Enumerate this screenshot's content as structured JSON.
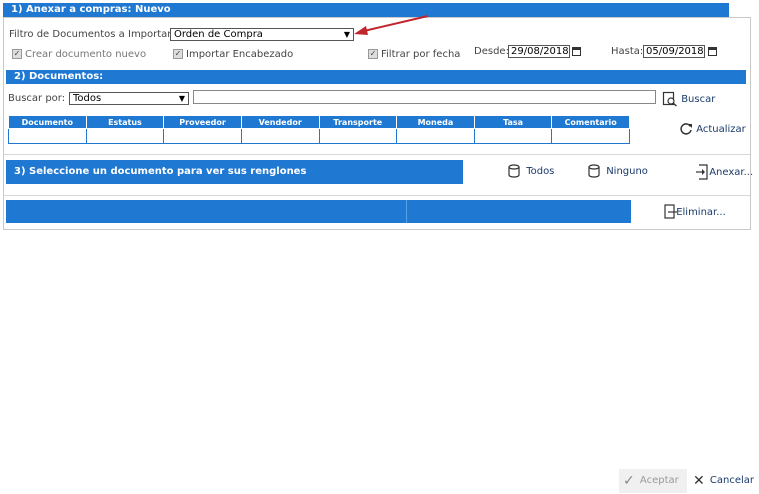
{
  "section1": {
    "title": "1) Anexar a compras: Nuevo",
    "filter_label": "Filtro de Documentos a Importar:",
    "filter_value": "Orden de Compra",
    "create_doc_label": "Crear documento nuevo",
    "import_header_label": "Importar Encabezado",
    "filter_date_label": "Filtrar por fecha",
    "from_label": "Desde:",
    "from_value": "29/08/2018",
    "to_label": "Hasta:",
    "to_value": "05/09/2018"
  },
  "section2": {
    "title": "2) Documentos:",
    "search_by_label": "Buscar por:",
    "search_by_value": "Todos",
    "search_input_value": "",
    "search_button": "Buscar",
    "refresh_button": "Actualizar",
    "columns": [
      "Documento",
      "Estatus",
      "Proveedor",
      "Vendedor",
      "Transporte",
      "Moneda",
      "Tasa",
      "Comentario"
    ]
  },
  "section3": {
    "title": "3) Seleccione un documento para ver sus renglones",
    "all_button": "Todos",
    "none_button": "Ninguno",
    "attach_button": "Anexar...",
    "delete_button": "Eliminar..."
  },
  "footer": {
    "accept_button": "Aceptar",
    "cancel_button": "Cancelar"
  },
  "colors": {
    "accent": "#1f78d1",
    "arrow": "#c0262c"
  },
  "icons": [
    "calendar-icon",
    "search-icon",
    "refresh-icon",
    "database-icon",
    "attach-icon",
    "delete-icon",
    "check-icon",
    "close-icon",
    "chevron-down-icon"
  ]
}
